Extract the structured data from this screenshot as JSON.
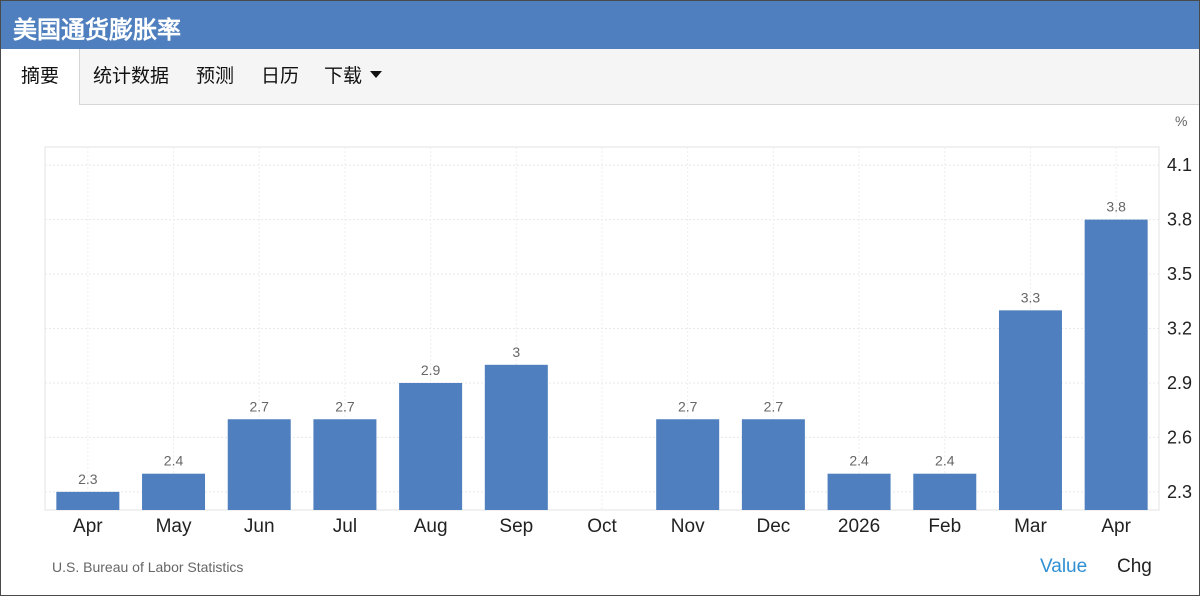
{
  "header": {
    "title": "美国通货膨胀率"
  },
  "tabs": [
    {
      "label": "摘要",
      "active": true
    },
    {
      "label": "统计数据"
    },
    {
      "label": "预测"
    },
    {
      "label": "日历"
    },
    {
      "label": "下载",
      "dropdown": true
    }
  ],
  "footer": {
    "source": "U.S. Bureau of Labor Statistics",
    "value_label": "Value",
    "chg_label": "Chg"
  },
  "colors": {
    "accent": "#4f7fbe",
    "bar": "#4f7fbe",
    "link": "#2f8fd3"
  },
  "chart_data": {
    "type": "bar",
    "categories": [
      "Apr",
      "May",
      "Jun",
      "Jul",
      "Aug",
      "Sep",
      "Oct",
      "Nov",
      "Dec",
      "2026",
      "Feb",
      "Mar",
      "Apr"
    ],
    "values": [
      2.3,
      2.4,
      2.7,
      2.7,
      2.9,
      3,
      null,
      2.7,
      2.7,
      2.4,
      2.4,
      3.3,
      3.8
    ],
    "data_labels": [
      "2.3",
      "2.4",
      "2.7",
      "2.7",
      "2.9",
      "3",
      "",
      "2.7",
      "2.7",
      "2.4",
      "2.4",
      "3.3",
      "3.8"
    ],
    "y_unit": "%",
    "y_ticks": [
      "4.1",
      "3.8",
      "3.5",
      "3.2",
      "2.9",
      "2.6",
      "2.3"
    ],
    "ylim": [
      2.2,
      4.2
    ],
    "y_axis_side": "right",
    "grid": true
  }
}
